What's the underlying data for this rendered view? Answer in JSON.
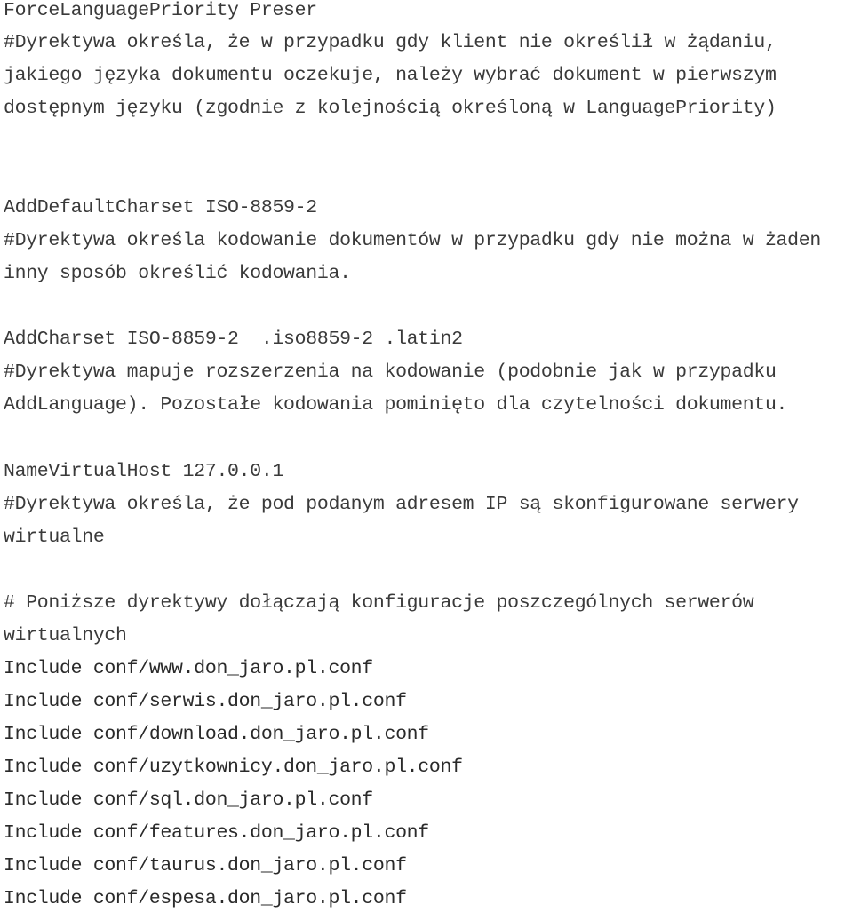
{
  "document": {
    "lines": [
      "ForceLanguagePriority Preser",
      "#Dyrektywa określa, że w przypadku gdy klient nie określił w żądaniu,",
      "jakiego języka dokumentu oczekuje, należy wybrać dokument w pierwszym",
      "dostępnym języku (zgodnie z kolejnością określoną w LanguagePriority)",
      "AddDefaultCharset ISO-8859-2",
      "#Dyrektywa określa kodowanie dokumentów w przypadku gdy nie można w żaden",
      "inny sposób określić kodowania.",
      "AddCharset ISO-8859-2  .iso8859-2 .latin2",
      "#Dyrektywa mapuje rozszerzenia na kodowanie (podobnie jak w przypadku",
      "AddLanguage). Pozostałe kodowania pominięto dla czytelności dokumentu.",
      "NameVirtualHost 127.0.0.1",
      "#Dyrektywa określa, że pod podanym adresem IP są skonfigurowane serwery",
      "wirtualne",
      "# Poniższe dyrektywy dołączają konfiguracje poszczególnych serwerów",
      "wirtualnych",
      "Include conf/www.don_jaro.pl.conf",
      "Include conf/serwis.don_jaro.pl.conf",
      "Include conf/download.don_jaro.pl.conf",
      "Include conf/uzytkownicy.don_jaro.pl.conf",
      "Include conf/sql.don_jaro.pl.conf",
      "Include conf/features.don_jaro.pl.conf",
      "Include conf/taurus.don_jaro.pl.conf",
      "Include conf/espesa.don_jaro.pl.conf"
    ]
  }
}
